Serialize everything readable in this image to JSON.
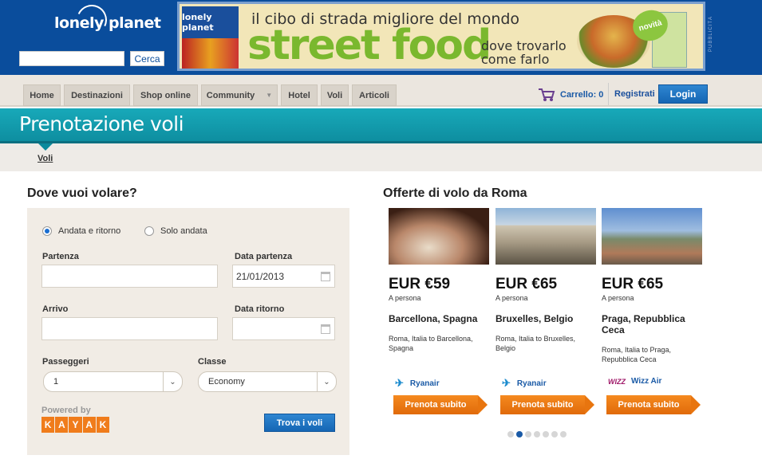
{
  "header": {
    "logo_text": "lonely planet",
    "search_button": "Cerca",
    "banner": {
      "logo_text": "lonely planet",
      "line1": "il cibo di strada migliore del mondo",
      "big_text": "street food",
      "sub_line1": "dove trovarlo",
      "sub_line2": "come farlo",
      "badge": "novità",
      "side_label": "PUBBLICITÀ"
    }
  },
  "nav": {
    "items": [
      {
        "label": "Home"
      },
      {
        "label": "Destinazioni"
      },
      {
        "label": "Shop online"
      },
      {
        "label": "Community"
      },
      {
        "label": "Hotel"
      },
      {
        "label": "Voli"
      },
      {
        "label": "Articoli"
      }
    ],
    "cart": "Carrello: 0",
    "registrati": "Registrati",
    "login": "Login"
  },
  "title": "Prenotazione voli",
  "subnav": {
    "active": "Voli"
  },
  "form": {
    "heading": "Dove vuoi volare?",
    "trip_options": [
      {
        "label": "Andata e ritorno",
        "selected": true
      },
      {
        "label": "Solo andata",
        "selected": false
      }
    ],
    "partenza_label": "Partenza",
    "partenza_value": "",
    "data_partenza_label": "Data partenza",
    "data_partenza_value": "21/01/2013",
    "arrivo_label": "Arrivo",
    "arrivo_value": "",
    "data_ritorno_label": "Data ritorno",
    "data_ritorno_value": "",
    "passeggeri_label": "Passeggeri",
    "passeggeri_value": "1",
    "classe_label": "Classe",
    "classe_value": "Economy",
    "powered_by": "Powered by",
    "kayak_letters": [
      "K",
      "A",
      "Y",
      "A",
      "K"
    ],
    "submit": "Trova i voli"
  },
  "offers": {
    "heading": "Offerte di volo da Roma",
    "items": [
      {
        "price": "EUR €59",
        "per": "A persona",
        "city": "Barcellona, Spagna",
        "route": "Roma, Italia to Barcellona, Spagna",
        "airline": "Ryanair",
        "button": "Prenota subito"
      },
      {
        "price": "EUR €65",
        "per": "A persona",
        "city": "Bruxelles, Belgio",
        "route": "Roma, Italia to Bruxelles, Belgio",
        "airline": "Ryanair",
        "button": "Prenota subito"
      },
      {
        "price": "EUR €65",
        "per": "A persona",
        "city": "Praga, Repubblica Ceca",
        "route": "Roma, Italia to Praga, Repubblica Ceca",
        "airline": "Wizz Air",
        "button": "Prenota subito"
      }
    ],
    "pager_total": 7,
    "pager_active": 2
  },
  "colors": {
    "header_blue": "#0a4d9c",
    "teal": "#18a9b9",
    "orange": "#f07c1b",
    "button_blue": "#1566b4"
  }
}
